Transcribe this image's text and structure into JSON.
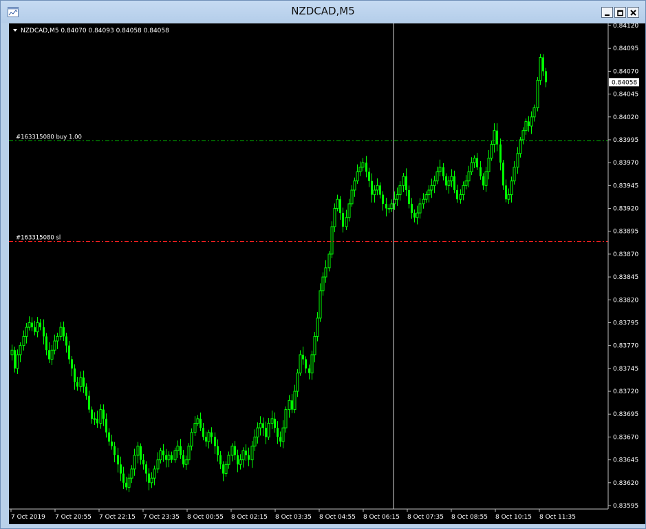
{
  "window": {
    "title": "NZDCAD,M5"
  },
  "chart_data": {
    "type": "candlestick",
    "symbol_info": "NZDCAD,M5  0.84070 0.84093 0.84058 0.84058",
    "y_ticks": [
      "0.84120",
      "0.84095",
      "0.84070",
      "0.84045",
      "0.84020",
      "0.83995",
      "0.83970",
      "0.83945",
      "0.83920",
      "0.83895",
      "0.83870",
      "0.83845",
      "0.83820",
      "0.83795",
      "0.83770",
      "0.83745",
      "0.83720",
      "0.83695",
      "0.83670",
      "0.83645",
      "0.83620",
      "0.83595"
    ],
    "x_ticks": [
      "7 Oct 2019",
      "7 Oct 20:55",
      "7 Oct 22:15",
      "7 Oct 23:35",
      "8 Oct 00:55",
      "8 Oct 02:15",
      "8 Oct 03:35",
      "8 Oct 04:55",
      "8 Oct 06:15",
      "8 Oct 07:35",
      "8 Oct 08:55",
      "8 Oct 10:15",
      "8 Oct 11:35"
    ],
    "ylim": [
      0.83595,
      0.8412
    ],
    "current_price": "0.84058",
    "order_lines": [
      {
        "label": "#163315080 buy 1.00",
        "price": 0.83994,
        "color": "#00c000"
      },
      {
        "label": "#163315080 sl",
        "price": 0.83884,
        "color": "#ff2020"
      }
    ],
    "candle_color": "#00ff00",
    "background": "#000000",
    "closes": [
      0.83765,
      0.83745,
      0.8376,
      0.8377,
      0.8378,
      0.8379,
      0.83795,
      0.8379,
      0.83785,
      0.83795,
      0.8379,
      0.8378,
      0.83765,
      0.83755,
      0.83765,
      0.83775,
      0.8378,
      0.8379,
      0.8378,
      0.8377,
      0.83755,
      0.83745,
      0.8373,
      0.83725,
      0.83735,
      0.83725,
      0.83715,
      0.837,
      0.8369,
      0.8369,
      0.83685,
      0.837,
      0.8369,
      0.83675,
      0.83665,
      0.8366,
      0.8365,
      0.8364,
      0.8363,
      0.8362,
      0.83615,
      0.83625,
      0.83635,
      0.8365,
      0.8366,
      0.83645,
      0.8364,
      0.8363,
      0.8362,
      0.83625,
      0.83635,
      0.83645,
      0.83655,
      0.8365,
      0.83645,
      0.8365,
      0.83645,
      0.83655,
      0.8366,
      0.8365,
      0.8364,
      0.83645,
      0.8366,
      0.83675,
      0.83685,
      0.8369,
      0.8368,
      0.8367,
      0.83665,
      0.83675,
      0.8367,
      0.8366,
      0.8365,
      0.8364,
      0.8363,
      0.8364,
      0.8365,
      0.8366,
      0.8365,
      0.8364,
      0.83645,
      0.83655,
      0.8365,
      0.83645,
      0.8366,
      0.8367,
      0.8368,
      0.83685,
      0.8368,
      0.8367,
      0.83685,
      0.8369,
      0.8368,
      0.8367,
      0.83665,
      0.8368,
      0.837,
      0.8371,
      0.837,
      0.8372,
      0.8374,
      0.8376,
      0.83755,
      0.83745,
      0.8374,
      0.8376,
      0.8378,
      0.838,
      0.8383,
      0.83845,
      0.83855,
      0.8387,
      0.839,
      0.8392,
      0.8393,
      0.83915,
      0.839,
      0.8391,
      0.83925,
      0.8394,
      0.8395,
      0.8396,
      0.83965,
      0.8397,
      0.8396,
      0.8395,
      0.83935,
      0.8394,
      0.83945,
      0.83935,
      0.83925,
      0.8392,
      0.8392,
      0.83925,
      0.8393,
      0.83935,
      0.83945,
      0.83955,
      0.8394,
      0.83925,
      0.83915,
      0.8391,
      0.83915,
      0.83925,
      0.8393,
      0.83935,
      0.8394,
      0.83945,
      0.8395,
      0.8396,
      0.83965,
      0.83955,
      0.83945,
      0.8395,
      0.83955,
      0.8394,
      0.8393,
      0.83935,
      0.83945,
      0.8395,
      0.8396,
      0.8397,
      0.83975,
      0.83965,
      0.83955,
      0.83945,
      0.8396,
      0.83975,
      0.8399,
      0.84005,
      0.8399,
      0.8397,
      0.83945,
      0.8393,
      0.83935,
      0.8395,
      0.83965,
      0.8398,
      0.83995,
      0.84005,
      0.84015,
      0.8401,
      0.8402,
      0.8403,
      0.8406,
      0.84085,
      0.8407,
      0.84058
    ]
  }
}
